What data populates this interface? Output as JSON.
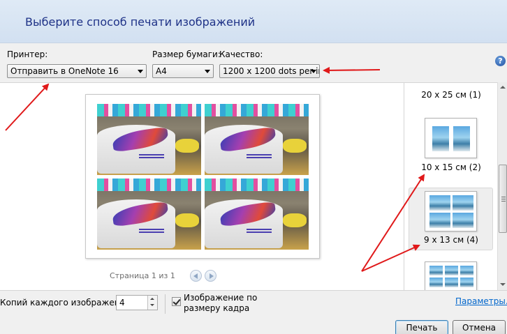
{
  "window": {
    "title": "Выберите способ печати изображений"
  },
  "controls": {
    "printer_label": "Принтер:",
    "printer_value": "Отправить в OneNote 16",
    "paper_label": "Размер бумаги:",
    "paper_value": "A4",
    "quality_label": "Качество:",
    "quality_value": "1200 x 1200 dots per in",
    "help_icon": "question-icon",
    "help_glyph": "?"
  },
  "preview": {
    "page_indicator": "Страница 1 из 1",
    "photo_count": 4
  },
  "layouts": [
    {
      "label": "20 x 25 см (1)"
    },
    {
      "label": "10 x 15 см (2)"
    },
    {
      "label": "9 x 13 см (4)",
      "selected": true
    },
    {
      "label": ""
    }
  ],
  "footer": {
    "copies_label": "Копий каждого изображения:",
    "copies_value": "4",
    "fit_label_line1": "Изображение по",
    "fit_label_line2": "размеру кадра",
    "fit_checked": true,
    "options_link": "Параметры...",
    "print_button": "Печать",
    "cancel_button": "Отмена"
  },
  "colors": {
    "title": "#1e3287",
    "annotation_arrow": "#e0191a",
    "link": "#0066cc"
  }
}
